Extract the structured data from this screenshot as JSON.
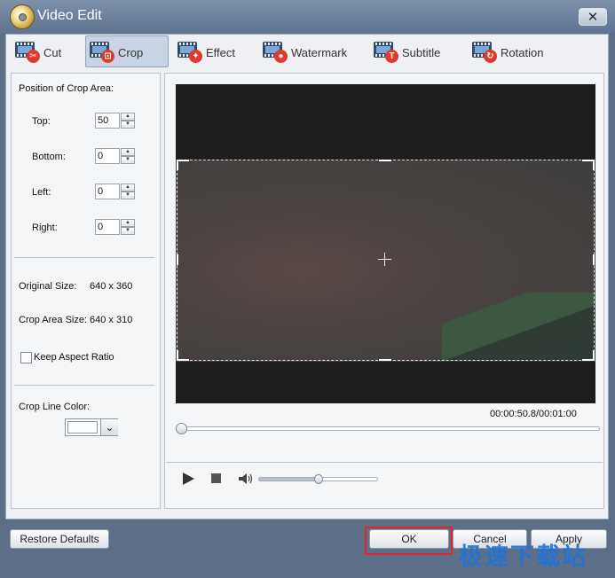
{
  "window": {
    "title": "Video Edit",
    "close_label": "✕"
  },
  "tabs": [
    {
      "label": "Cut",
      "active": false,
      "icon": "scissors-icon"
    },
    {
      "label": "Crop",
      "active": true,
      "icon": "crop-icon"
    },
    {
      "label": "Effect",
      "active": false,
      "icon": "effect-icon"
    },
    {
      "label": "Watermark",
      "active": false,
      "icon": "watermark-icon"
    },
    {
      "label": "Subtitle",
      "active": false,
      "icon": "subtitle-icon"
    },
    {
      "label": "Rotation",
      "active": false,
      "icon": "rotation-icon"
    }
  ],
  "crop": {
    "section_title": "Position of Crop Area:",
    "top_label": "Top:",
    "top_value": "50",
    "bottom_label": "Bottom:",
    "bottom_value": "0",
    "left_label": "Left:",
    "left_value": "0",
    "right_label": "Right:",
    "right_value": "0",
    "original_size_label": "Original Size:",
    "original_size_value": "640 x 360",
    "crop_size_label": "Crop Area Size:",
    "crop_size_value": "640 x 310",
    "keep_aspect_label": "Keep Aspect Ratio",
    "keep_aspect_checked": false,
    "line_color_label": "Crop Line Color:",
    "line_color": "#ffffff"
  },
  "player": {
    "timecode": "00:00:50.8/00:01:00",
    "seek_position": 0.0,
    "volume_level": 0.5
  },
  "buttons": {
    "restore_defaults": "Restore Defaults",
    "ok": "OK",
    "cancel": "Cancel",
    "apply": "Apply"
  },
  "watermark_text": "极速下载站",
  "colors": {
    "highlight": "#e0262c",
    "watermark": "#1f73d8",
    "active_tab": "#c8d3e3"
  }
}
